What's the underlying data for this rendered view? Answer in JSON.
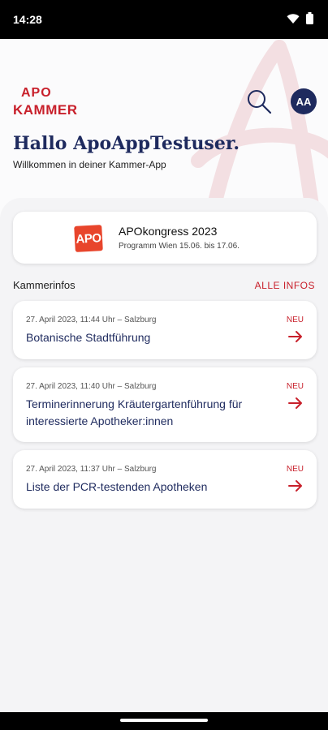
{
  "status_bar": {
    "time": "14:28",
    "icons": [
      "wifi-icon",
      "battery-icon"
    ]
  },
  "logo": {
    "line1": "APO",
    "line2": "KAMMER"
  },
  "header": {
    "search_icon": "search-icon",
    "avatar_initials": "AA",
    "greeting": "Hallo ApoAppTestuser.",
    "sub_greeting": "Willkommen in deiner Kammer-App"
  },
  "event": {
    "logo_text": "APO",
    "title": "APOkongress 2023",
    "subtitle": "Programm Wien 15.06. bis 17.06."
  },
  "kammerinfos": {
    "title": "Kammerinfos",
    "all_link": "ALLE INFOS",
    "items": [
      {
        "meta": "27. April 2023, 11:44 Uhr – Salzburg",
        "title": "Botanische Stadtführung",
        "badge": "NEU"
      },
      {
        "meta": "27. April 2023, 11:40 Uhr – Salzburg",
        "title": "Terminerinnerung Kräutergartenführung für interessierte Apotheker:innen",
        "badge": "NEU"
      },
      {
        "meta": "27. April 2023, 11:37 Uhr – Salzburg",
        "title": "Liste der PCR-testenden Apotheken",
        "badge": "NEU"
      }
    ]
  },
  "colors": {
    "brand_red": "#c8202b",
    "navy": "#1e2a5e",
    "panel_bg": "#f4f4f6"
  }
}
